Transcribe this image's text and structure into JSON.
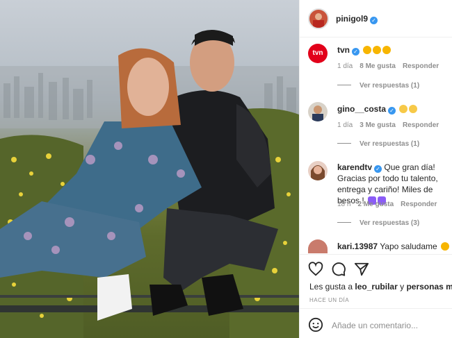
{
  "post": {
    "author": "pinigol9",
    "verified": true
  },
  "comments": [
    {
      "username": "tvn",
      "verified": true,
      "text": "",
      "emojis": [
        "star-eyes-emoji",
        "star-eyes-emoji",
        "star-eyes-emoji"
      ],
      "time": "1 día",
      "likes": "8 Me gusta",
      "reply": "Responder",
      "view_replies": "Ver respuestas (1)"
    },
    {
      "username": "gino__costa",
      "verified": true,
      "text": "",
      "emojis": [
        "clapping-hands-emoji",
        "clapping-hands-emoji"
      ],
      "time": "1 día",
      "likes": "3 Me gusta",
      "reply": "Responder",
      "view_replies": "Ver respuestas (1)"
    },
    {
      "username": "karendtv",
      "verified": true,
      "text": "Que gran día! Gracias por todo tu talento, entrega y cariño! Miles de besos !",
      "emojis": [
        "purple-heart-emoji",
        "purple-heart-emoji"
      ],
      "time": "18 h",
      "likes": "2 Me gusta",
      "reply": "Responder",
      "view_replies": "Ver respuestas (3)"
    },
    {
      "username": "kari.13987",
      "verified": false,
      "text": "Yapo saludame",
      "emojis": [
        "sad-face-emoji"
      ]
    }
  ],
  "likes": {
    "prefix": "Les gusta a",
    "user": "leo_rubilar",
    "connector": "y",
    "others": "personas más"
  },
  "timestamp": "HACE UN DÍA",
  "comment_input": {
    "placeholder": "Añade un comentario..."
  },
  "colors": {
    "verified": "#3897f0",
    "muted": "#8e8e8e",
    "text": "#262626",
    "tvn_red": "#e2001a"
  }
}
